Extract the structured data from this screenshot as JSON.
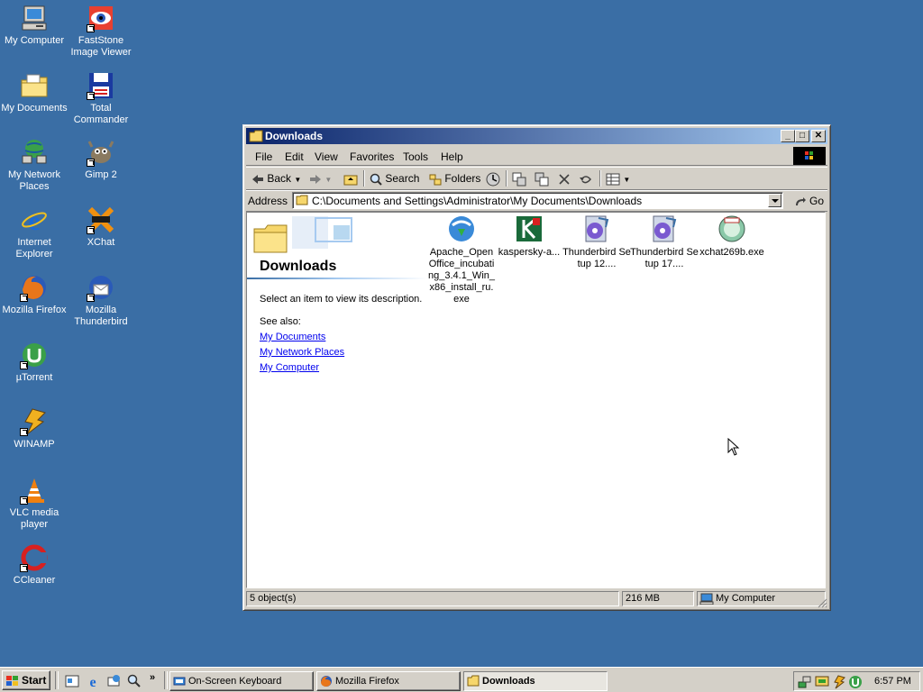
{
  "desktop": {
    "icons": [
      {
        "label": "My Computer"
      },
      {
        "label": "My Documents"
      },
      {
        "label": "My Network Places"
      },
      {
        "label": "Internet Explorer"
      },
      {
        "label": "Mozilla Firefox"
      },
      {
        "label": "µTorrent"
      },
      {
        "label": "WINAMP"
      },
      {
        "label": "VLC media player"
      },
      {
        "label": "CCleaner"
      },
      {
        "label": "FastStone Image Viewer"
      },
      {
        "label": "Total Commander"
      },
      {
        "label": "Gimp 2"
      },
      {
        "label": "XChat"
      },
      {
        "label": "Mozilla Thunderbird"
      }
    ]
  },
  "window": {
    "title": "Downloads",
    "menu": [
      "File",
      "Edit",
      "View",
      "Favorites",
      "Tools",
      "Help"
    ],
    "toolbar": {
      "back": "Back",
      "search": "Search",
      "folders": "Folders"
    },
    "address": {
      "label": "Address",
      "path": "C:\\Documents and Settings\\Administrator\\My Documents\\Downloads",
      "go": "Go"
    },
    "left_panel": {
      "title": "Downloads",
      "description": "Select an item to view its description.",
      "see_also": "See also:",
      "links": [
        "My Documents",
        "My Network Places",
        "My Computer"
      ]
    },
    "files": [
      {
        "name": "Apache_OpenOffice_incubating_3.4.1_Win_x86_install_ru.exe"
      },
      {
        "name": "kaspersky-a..."
      },
      {
        "name": "Thunderbird Setup 12...."
      },
      {
        "name": "Thunderbird Setup 17...."
      },
      {
        "name": "xchat269b.exe"
      }
    ],
    "status": {
      "objects": "5 object(s)",
      "size": "216 MB",
      "zone": "My Computer"
    }
  },
  "taskbar": {
    "start": "Start",
    "tasks": [
      "On-Screen Keyboard",
      "Mozilla Firefox",
      "Downloads"
    ],
    "clock": "6:57 PM"
  },
  "colors": {
    "desktop": "#3a6ea5",
    "titlebar": "#0a246a",
    "face": "#d4d0c8",
    "link": "#0000ee"
  }
}
